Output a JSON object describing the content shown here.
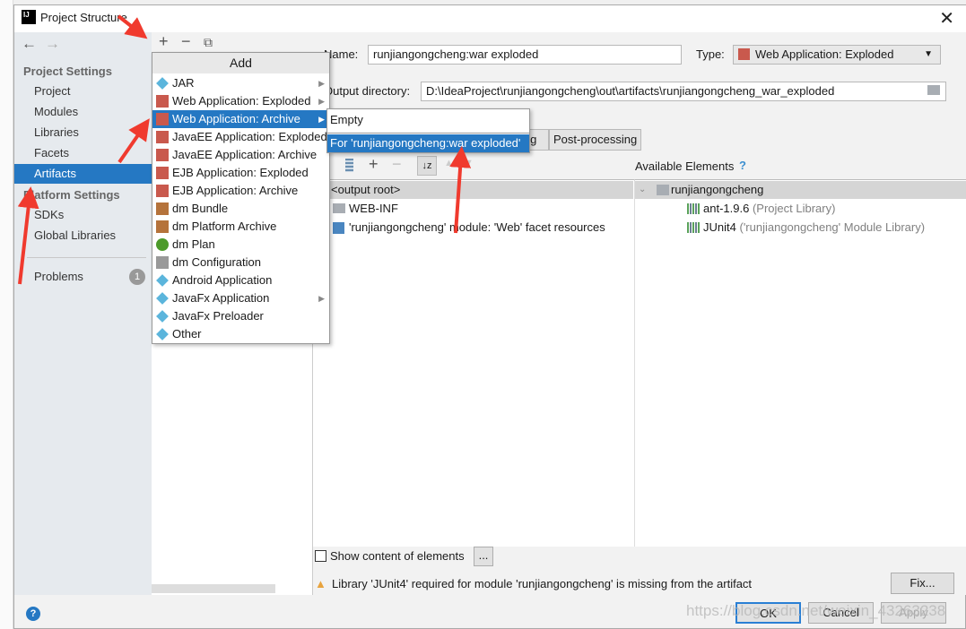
{
  "window": {
    "title": "Project Structure"
  },
  "sidebar": {
    "project_settings": "Project Settings",
    "items": [
      "Project",
      "Modules",
      "Libraries",
      "Facets",
      "Artifacts"
    ],
    "selected": "Artifacts",
    "platform_settings": "Platform Settings",
    "platform_items": [
      "SDKs",
      "Global Libraries"
    ],
    "problems": "Problems",
    "problems_count": "1"
  },
  "menu": {
    "header": "Add",
    "items": [
      {
        "label": "JAR",
        "icon": "jar-icon",
        "submenu": true
      },
      {
        "label": "Web Application: Exploded",
        "icon": "web-app-icon",
        "submenu": true
      },
      {
        "label": "Web Application: Archive",
        "icon": "web-app-icon",
        "submenu": true,
        "selected": true
      },
      {
        "label": "JavaEE Application: Exploded",
        "icon": "javaee-icon"
      },
      {
        "label": "JavaEE Application: Archive",
        "icon": "javaee-icon"
      },
      {
        "label": "EJB Application: Exploded",
        "icon": "ejb-icon"
      },
      {
        "label": "EJB Application: Archive",
        "icon": "ejb-icon"
      },
      {
        "label": "dm Bundle",
        "icon": "dm-bundle-icon"
      },
      {
        "label": "dm Platform Archive",
        "icon": "dm-bundle-icon"
      },
      {
        "label": "dm Plan",
        "icon": "dm-plan-icon"
      },
      {
        "label": "dm Configuration",
        "icon": "file-icon"
      },
      {
        "label": "Android Application",
        "icon": "jar-icon"
      },
      {
        "label": "JavaFx Application",
        "icon": "jar-icon",
        "submenu": true
      },
      {
        "label": "JavaFx Preloader",
        "icon": "jar-icon"
      },
      {
        "label": "Other",
        "icon": "jar-icon"
      }
    ]
  },
  "submenu": {
    "items": [
      "Empty",
      "For 'runjiangongcheng:war exploded'"
    ]
  },
  "artifact": {
    "name_label": "Name:",
    "name_value": "runjiangongcheng:war exploded",
    "type_label": "Type:",
    "type_value": "Web Application: Exploded",
    "output_label": "Output directory:",
    "output_value": "D:\\IdeaProject\\runjiangongcheng\\out\\artifacts\\runjiangongcheng_war_exploded",
    "tabs": [
      "ing",
      "Post-processing"
    ],
    "available_label": "Available Elements",
    "tree": [
      "<output root>",
      "WEB-INF",
      "'runjiangongcheng' module: 'Web' facet resources"
    ],
    "available": {
      "root": "runjiangongcheng",
      "items": [
        {
          "name": "ant-1.9.6",
          "note": "(Project Library)"
        },
        {
          "name": "JUnit4",
          "note": "('runjiangongcheng' Module Library)"
        }
      ]
    },
    "show_content": "Show content of elements",
    "ellipsis": "...",
    "warning": "Library 'JUnit4' required for module 'runjiangongcheng' is missing from the artifact",
    "fix": "Fix..."
  },
  "footer": {
    "ok": "OK",
    "cancel": "Cancel",
    "apply": "Apply",
    "help": "?"
  },
  "watermark": "https://blog.csdn.net/weixin_43263238",
  "colors": {
    "selection": "#2578c3",
    "annotation_arrow": "#f03a2e"
  }
}
